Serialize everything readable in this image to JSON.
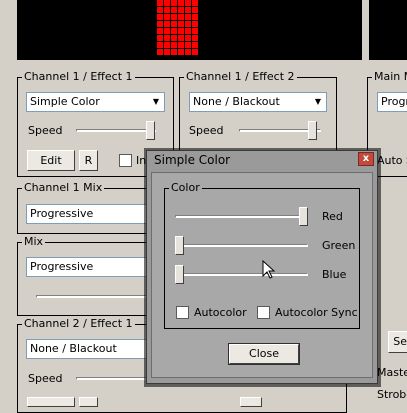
{
  "panels": {
    "ch1_effect1": {
      "title": "Channel 1 / Effect 1",
      "effect_value": "Simple Color",
      "speed_label": "Speed",
      "speed_level": 0.95,
      "edit_label": "Edit",
      "r_label": "R",
      "checkbox_label": "In"
    },
    "ch1_effect2": {
      "title": "Channel 1 / Effect 2",
      "effect_value": "None / Blackout",
      "speed_label": "Speed",
      "speed_level": 0.95
    },
    "main_mix": {
      "title": "Main M",
      "mode_value": "Progre",
      "auto_label": "Auto S"
    },
    "ch1_mix": {
      "title": "Channel 1 Mix",
      "mode_value": "Progressive"
    },
    "mix": {
      "title": "Mix",
      "mode_value": "Progressive"
    },
    "ch2_effect1": {
      "title": "Channel 2 / Effect 1",
      "effect_value": "None / Blackout",
      "speed_label": "Speed"
    },
    "right_bottom": {
      "se_label": "Se",
      "master_label": "Master",
      "strobe_label": "Strobe"
    }
  },
  "dialog": {
    "title": "Simple Color",
    "close_symbol": "x",
    "color_group": "Color",
    "red_label": "Red",
    "green_label": "Green",
    "blue_label": "Blue",
    "red_level": 1.0,
    "green_level": 0.0,
    "blue_level": 0.0,
    "autocolor_label": "Autocolor",
    "autocolor_sync_label": "Autocolor Sync",
    "close_button": "Close"
  },
  "colors": {
    "led": "#ff0000",
    "effect_border": "#c43a3a",
    "mix_border": "#2aa82a",
    "ch2_border": "#3a3acb",
    "main_border": "#b5b53a"
  }
}
